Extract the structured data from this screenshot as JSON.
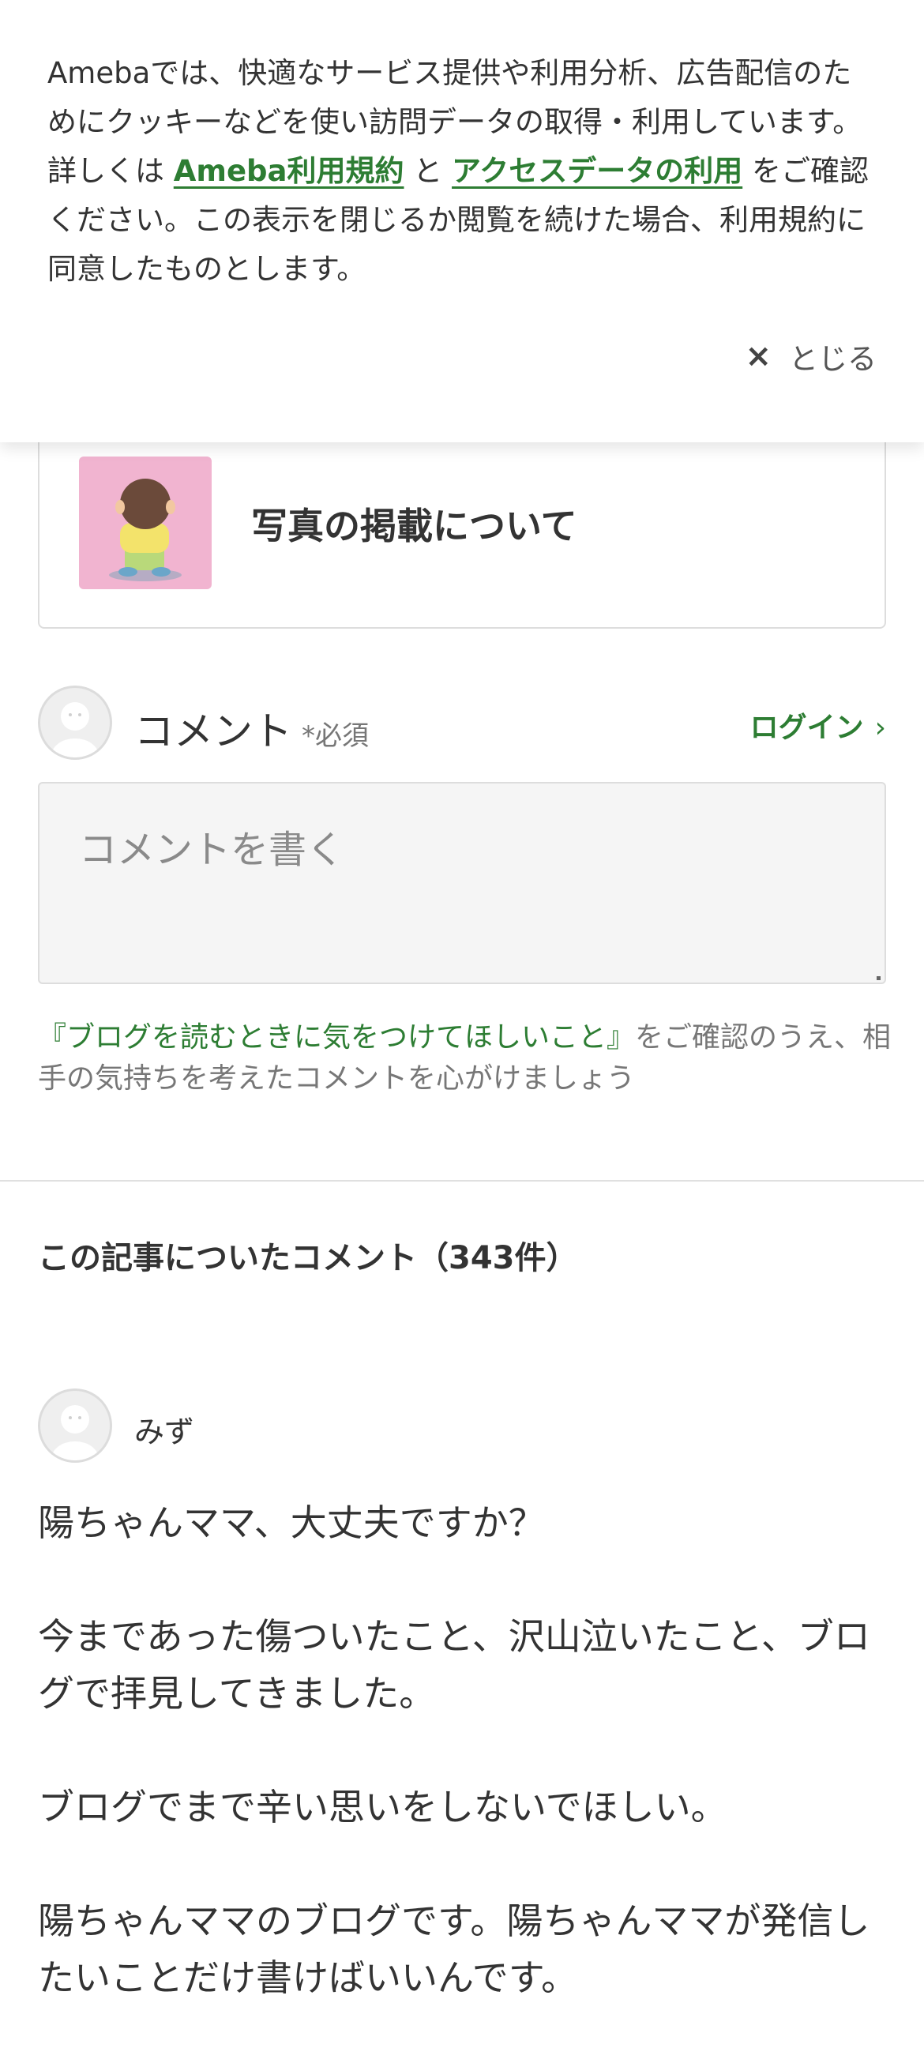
{
  "cookie_banner": {
    "text_before": "Amebaでは、快適なサービス提供や利用分析、広告配信のためにクッキーなどを使い訪問データの取得・利用しています。詳しくは ",
    "link_terms": "Ameba利用規約",
    "text_and": " と ",
    "link_access": "アクセスデータの利用",
    "text_after": " をご確認ください。この表示を閉じるか閲覧を続けた場合、利用規約に同意したものとします。",
    "close_icon": "×",
    "close_label": "とじる"
  },
  "related_article": {
    "title": "写真の掲載について"
  },
  "comment_form": {
    "label": "コメント",
    "required": "*必須",
    "login_label": "ログイン",
    "login_chevron": "›",
    "placeholder": "コメントを書く",
    "guide_link": "『ブログを読むときに気をつけてほしいこと』",
    "guide_text": "をご確認のうえ、相手の気持ちを考えたコメントを心がけましょう"
  },
  "comments": {
    "title": "この記事についたコメント（343件）",
    "items": [
      {
        "author": "みず",
        "paragraphs": [
          "陽ちゃんママ、大丈夫ですか？",
          "今まであった傷ついたこと、沢山泣いたこと、ブログで拝見してきました。",
          "ブログでまで辛い思いをしないでほしい。",
          "陽ちゃんママのブログです。陽ちゃんママが発信したいことだけ書けばいいんです。"
        ]
      }
    ]
  },
  "colors": {
    "accent_green": "#2d7d33",
    "thumb_bg": "#f1b4d0"
  },
  "icons": {
    "close": "close-icon",
    "chevron": "chevron-right-icon",
    "avatar": "default-avatar-icon"
  }
}
